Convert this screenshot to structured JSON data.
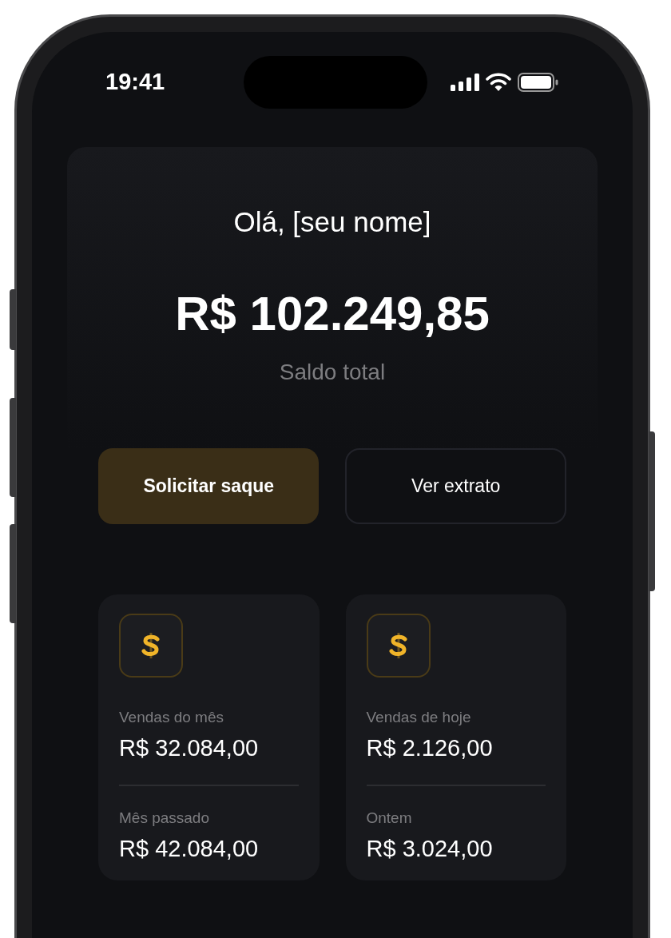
{
  "status_bar": {
    "time": "19:41"
  },
  "greeting": "Olá, [seu nome]",
  "balance": {
    "amount": "R$ 102.249,85",
    "label": "Saldo total"
  },
  "actions": [
    {
      "label": "Solicitar saque",
      "kind": "primary"
    },
    {
      "label": "Ver extrato",
      "kind": "secondary"
    }
  ],
  "stats": [
    {
      "title": "Vendas do mês",
      "value": "R$ 32.084,00",
      "previous_label": "Mês passado",
      "previous_value": "R$ 42.084,00"
    },
    {
      "title": "Vendas de hoje",
      "value": "R$ 2.126,00",
      "previous_label": "Ontem",
      "previous_value": "R$ 3.024,00"
    }
  ]
}
